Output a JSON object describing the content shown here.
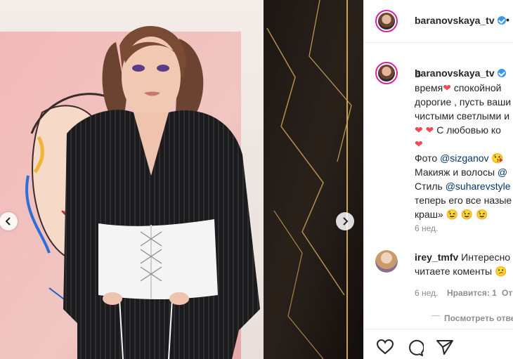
{
  "post": {
    "username": "baranovskaya_tv",
    "follow_dot": "•",
    "caption_lines": [
      {
        "segments": [
          {
            "text": "В",
            "type": "text"
          }
        ]
      },
      {
        "segments": [
          {
            "text": "время",
            "type": "text"
          },
          {
            "text": "❤",
            "type": "heart"
          },
          {
            "text": " спокойной",
            "type": "text"
          }
        ]
      },
      {
        "segments": [
          {
            "text": "дорогие , пусть ваши",
            "type": "text"
          }
        ]
      },
      {
        "segments": [
          {
            "text": "чистыми светлыми и",
            "type": "text"
          }
        ]
      },
      {
        "segments": [
          {
            "text": "❤ ❤",
            "type": "heart"
          },
          {
            "text": " С любовью ко",
            "type": "text"
          }
        ]
      },
      {
        "segments": [
          {
            "text": "❤",
            "type": "heart"
          }
        ]
      },
      {
        "segments": [
          {
            "text": "Фото ",
            "type": "text"
          },
          {
            "text": "@sizganov",
            "type": "mention"
          },
          {
            "text": " 😘",
            "type": "text"
          }
        ]
      },
      {
        "segments": [
          {
            "text": "Макияж и волосы ",
            "type": "text"
          },
          {
            "text": "@",
            "type": "mention"
          }
        ]
      },
      {
        "segments": [
          {
            "text": "Стиль ",
            "type": "text"
          },
          {
            "text": "@suharevstyle",
            "type": "mention"
          }
        ]
      },
      {
        "segments": [
          {
            "text": "теперь его все назые",
            "type": "text"
          }
        ]
      },
      {
        "segments": [
          {
            "text": "краш» 😉 😉 😉",
            "type": "text"
          }
        ]
      }
    ],
    "caption_time": "6 нед.",
    "comment": {
      "username": "irey_tmfv",
      "text_line1": "Интересно",
      "text_line2": "читаете коменты 😕",
      "time": "6 нед.",
      "likes": "Нравится: 1",
      "reply": "От"
    },
    "view_replies": "Посмотреть отве"
  },
  "icons": {
    "like": "heart-outline-icon",
    "comment": "comment-bubble-icon",
    "share": "paper-plane-icon",
    "prev": "chevron-left-icon",
    "next": "chevron-right-icon"
  },
  "colors": {
    "verified": "#3897f0",
    "mention": "#00376b",
    "heart": "#ed4956",
    "muted": "#8e8e8e"
  }
}
